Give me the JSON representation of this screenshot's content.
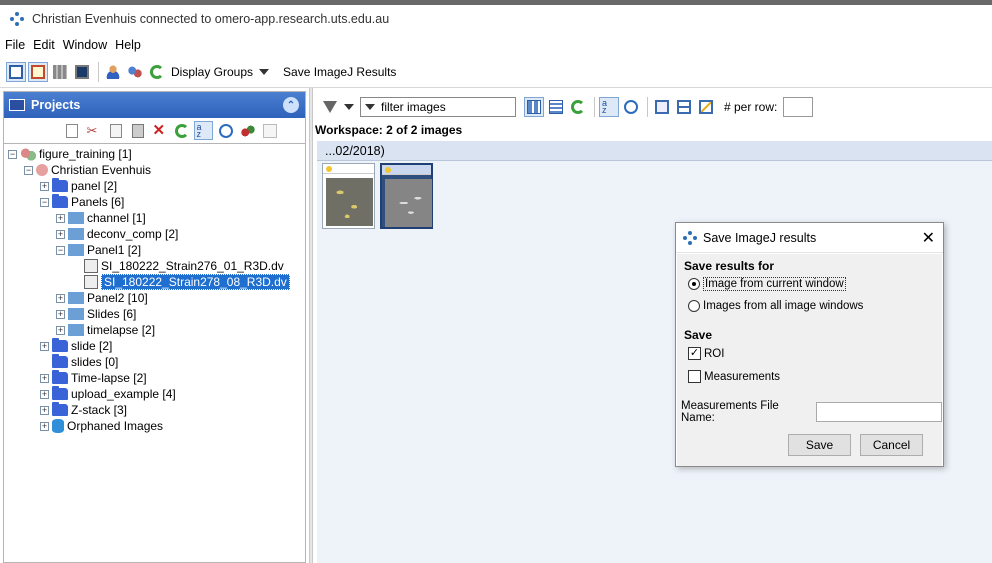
{
  "window": {
    "title": "Christian Evenhuis connected to omero-app.research.uts.edu.au",
    "menu": [
      "File",
      "Edit",
      "Window",
      "Help"
    ]
  },
  "toolbar": {
    "icons": [
      "view-icon",
      "annotate-icon",
      "grid-icon",
      "display-icon",
      "user-icon",
      "group-icon",
      "refresh-icon"
    ],
    "display_groups_label": "Display Groups",
    "save_imagej_label": "Save ImageJ Results"
  },
  "projects_panel": {
    "title": "Projects",
    "tools": [
      "new-icon",
      "cut-icon",
      "copy-icon",
      "paste-icon",
      "delete-icon",
      "refresh-icon",
      "sort-icon",
      "history-icon",
      "import-icon",
      "minus-icon"
    ],
    "tree": [
      {
        "label": "figure_training [1]",
        "icon": "group-icon",
        "level": 0,
        "expander": "-"
      },
      {
        "label": "Christian Evenhuis",
        "icon": "person-icon",
        "level": 1,
        "expander": "-"
      },
      {
        "label": "panel [2]",
        "icon": "folder-icon",
        "level": 2,
        "expander": "+"
      },
      {
        "label": "Panels [6]",
        "icon": "folder-icon",
        "level": 2,
        "expander": "-"
      },
      {
        "label": "channel [1]",
        "icon": "dataset-icon",
        "level": 3,
        "expander": "+"
      },
      {
        "label": "deconv_comp [2]",
        "icon": "dataset-icon",
        "level": 3,
        "expander": "+"
      },
      {
        "label": "Panel1 [2]",
        "icon": "dataset-icon",
        "level": 3,
        "expander": "-"
      },
      {
        "label": "SI_180222_Strain276_01_R3D.dv",
        "icon": "image-icon",
        "level": 4,
        "expander": ""
      },
      {
        "label": "SI_180222_Strain278_08_R3D.dv",
        "icon": "image-icon",
        "level": 4,
        "expander": "",
        "selected": true
      },
      {
        "label": "Panel2 [10]",
        "icon": "dataset-icon",
        "level": 3,
        "expander": "+"
      },
      {
        "label": "Slides [6]",
        "icon": "dataset-icon",
        "level": 3,
        "expander": "+"
      },
      {
        "label": "timelapse [2]",
        "icon": "dataset-icon",
        "level": 3,
        "expander": "+"
      },
      {
        "label": "slide [2]",
        "icon": "folder-icon",
        "level": 2,
        "expander": "+"
      },
      {
        "label": "slides [0]",
        "icon": "folder-icon",
        "level": 2,
        "expander": ""
      },
      {
        "label": "Time-lapse [2]",
        "icon": "folder-icon",
        "level": 2,
        "expander": "+"
      },
      {
        "label": "upload_example [4]",
        "icon": "folder-icon",
        "level": 2,
        "expander": "+"
      },
      {
        "label": "Z-stack [3]",
        "icon": "folder-icon",
        "level": 2,
        "expander": "+"
      },
      {
        "label": "Orphaned Images",
        "icon": "cylinder-icon",
        "level": 2,
        "expander": "+"
      }
    ]
  },
  "workspace": {
    "filter_text": "filter  images",
    "per_row_label": "# per row:",
    "per_row_value": "",
    "title": "Workspace: 2 of 2 images",
    "tab_label": "...02/2018)",
    "thumbnails": [
      {
        "selected": false
      },
      {
        "selected": true
      }
    ]
  },
  "dialog": {
    "title": "Save ImageJ results",
    "section_save_for": "Save results for",
    "option_current": "Image from current window",
    "option_all": "Images from all image windows",
    "selected_option": "current",
    "section_save": "Save",
    "roi_label": "ROI",
    "roi_checked": true,
    "measurements_label": "Measurements",
    "measurements_checked": false,
    "file_name_label": "Measurements File Name:",
    "file_name_value": "",
    "save_button": "Save",
    "cancel_button": "Cancel"
  }
}
